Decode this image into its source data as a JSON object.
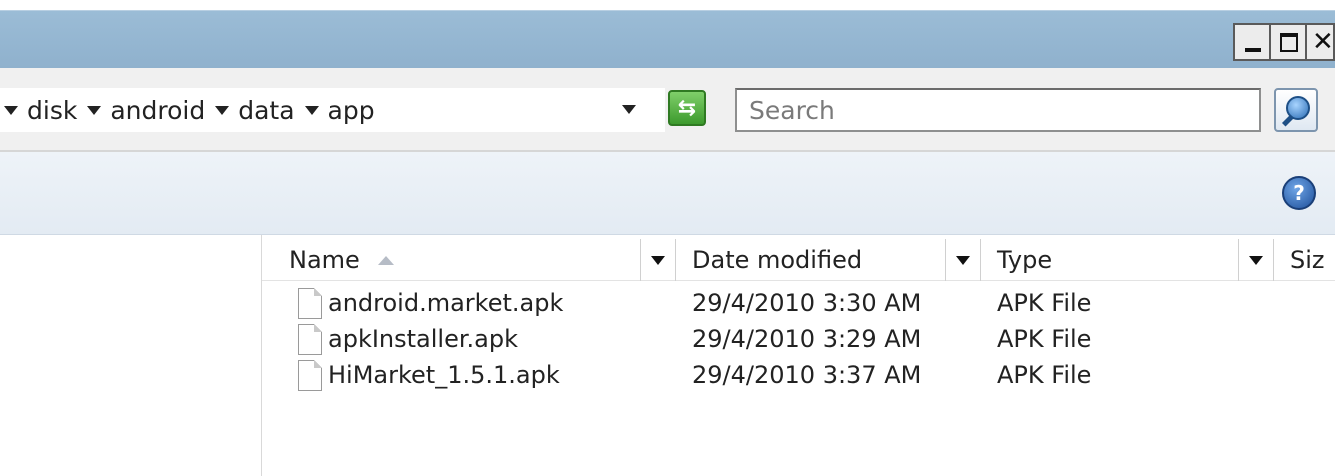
{
  "window": {
    "minimize_label": "_",
    "maximize_label": "□",
    "close_label": "×"
  },
  "address": {
    "crumbs": [
      "disk",
      "android",
      "data",
      "app"
    ]
  },
  "search": {
    "placeholder": "Search"
  },
  "icons": {
    "refresh": "refresh-arrows-icon",
    "search": "magnifier-icon",
    "help": "help-icon",
    "file": "file-icon"
  },
  "columns": {
    "name": "Name",
    "date": "Date modified",
    "type": "Type",
    "size": "Siz"
  },
  "files": [
    {
      "name": "android.market.apk",
      "date": "29/4/2010 3:30 AM",
      "type": "APK File"
    },
    {
      "name": "apkInstaller.apk",
      "date": "29/4/2010 3:29 AM",
      "type": "APK File"
    },
    {
      "name": "HiMarket_1.5.1.apk",
      "date": "29/4/2010 3:37 AM",
      "type": "APK File"
    }
  ],
  "help": {
    "glyph": "?"
  },
  "refresh": {
    "glyph": "⇆"
  }
}
